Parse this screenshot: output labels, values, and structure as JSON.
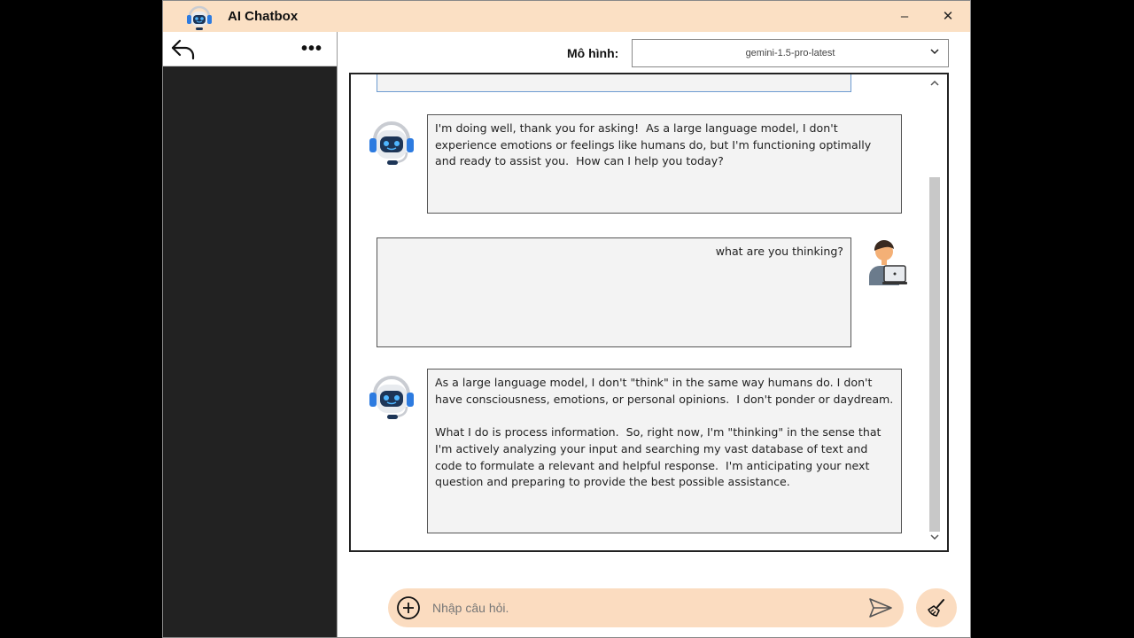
{
  "window": {
    "title": "AI Chatbox",
    "minimize_glyph": "–",
    "close_glyph": "✕"
  },
  "sidebar": {
    "more_glyph": "•••"
  },
  "toolbar": {
    "model_label": "Mô hình:",
    "model_value": "gemini-1.5-pro-latest",
    "chevron_glyph": "⌄"
  },
  "messages": [
    {
      "role": "bot",
      "text": "I'm doing well, thank you for asking!  As a large language model, I don't experience emotions or feelings like humans do, but I'm functioning optimally and ready to assist you.  How can I help you today?"
    },
    {
      "role": "user",
      "text": "what are you thinking?"
    },
    {
      "role": "bot",
      "text": "As a large language model, I don't \"think\" in the same way humans do. I don't have consciousness, emotions, or personal opinions.  I don't ponder or daydream.\n\nWhat I do is process information.  So, right now, I'm \"thinking\" in the sense that I'm actively analyzing your input and searching my vast database of text and code to formulate a relevant and helpful response.  I'm anticipating your next question and preparing to provide the best possible assistance."
    }
  ],
  "input": {
    "placeholder": "Nhập câu hỏi."
  },
  "colors": {
    "titlebar": "#fbe0c4",
    "input_bar": "#fbdcc0",
    "sidebar_bg": "#222222",
    "bubble_bg": "#f3f3f3",
    "bot_accent": "#1f7ae0"
  },
  "icons": {
    "app": "robot-headset-icon",
    "back": "reply-arrow-icon",
    "more": "more-dots-icon",
    "bot_avatar": "robot-headset-icon",
    "user_avatar": "user-laptop-icon",
    "add": "plus-circle-icon",
    "send": "send-icon",
    "clear": "broom-icon"
  }
}
